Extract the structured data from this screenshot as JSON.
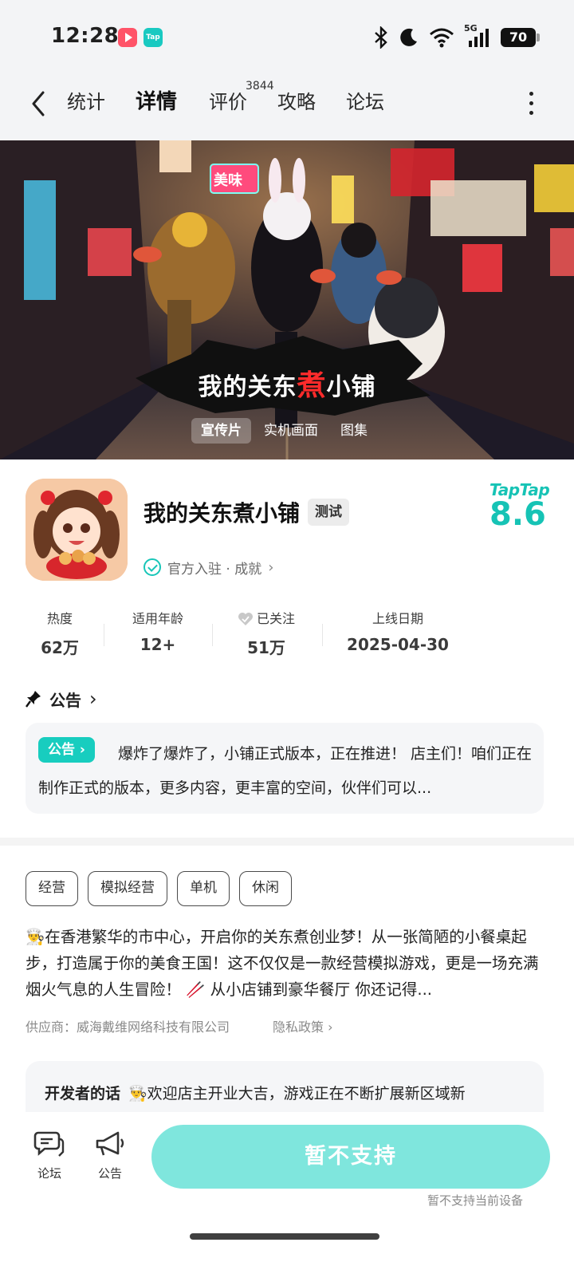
{
  "status_bar": {
    "time": "12:28",
    "network": "5G",
    "battery": "70"
  },
  "nav": {
    "tabs": [
      {
        "label": "统计"
      },
      {
        "label": "详情"
      },
      {
        "label": "评价"
      },
      {
        "label": "攻略"
      },
      {
        "label": "论坛"
      }
    ],
    "active_tab": "详情",
    "review_count": "3844"
  },
  "hero": {
    "title_part1": "我的关东",
    "title_highlight": "煮",
    "title_part2": "小铺",
    "shop_sign": "美味",
    "media_tabs": [
      {
        "label": "宣传片"
      },
      {
        "label": "实机画面"
      },
      {
        "label": "图集"
      }
    ],
    "active_media_tab": "宣传片"
  },
  "game": {
    "name": "我的关东煮小铺",
    "badge": "测试",
    "official_text": "官方入驻 · 成就",
    "platform_logo": "TapTap",
    "rating": "8.6"
  },
  "stats": [
    {
      "label": "热度",
      "value": "62万"
    },
    {
      "label": "适用年龄",
      "value": "12+"
    },
    {
      "label": "已关注",
      "value": "51万"
    },
    {
      "label": "上线日期",
      "value": "2025-04-30"
    }
  ],
  "notice": {
    "heading": "公告",
    "pill": "公告",
    "text": "爆炸了爆炸了，小铺正式版本，正在推进！ 店主们！咱们正在制作正式的版本，更多内容，更丰富的空间，伙伴们可以..."
  },
  "tags": [
    "经营",
    "模拟经营",
    "单机",
    "休闲"
  ],
  "description": "👨‍🍳在香港繁华的市中心，开启你的关东煮创业梦！从一张简陋的小餐桌起步，打造属于你的美食王国！这不仅仅是一款经营模拟游戏，更是一场充满烟火气息的人生冒险！ 🥢 从小店铺到豪华餐厅 你还记得...",
  "supplier": "供应商：威海戴维网络科技有限公司",
  "privacy": "隐私政策",
  "developer": {
    "heading": "开发者的话",
    "text": "👨‍🍳欢迎店主开业大吉，游戏正在不断扩展新区域新"
  },
  "bottom_bar": {
    "forum_label": "论坛",
    "notice_label": "公告",
    "cta_label": "暂不支持",
    "cta_note": "暂不支持当前设备"
  },
  "colors": {
    "accent": "#18cdbf",
    "cta": "#7fe6dd",
    "hero_title_highlight": "#ff2b2b"
  }
}
